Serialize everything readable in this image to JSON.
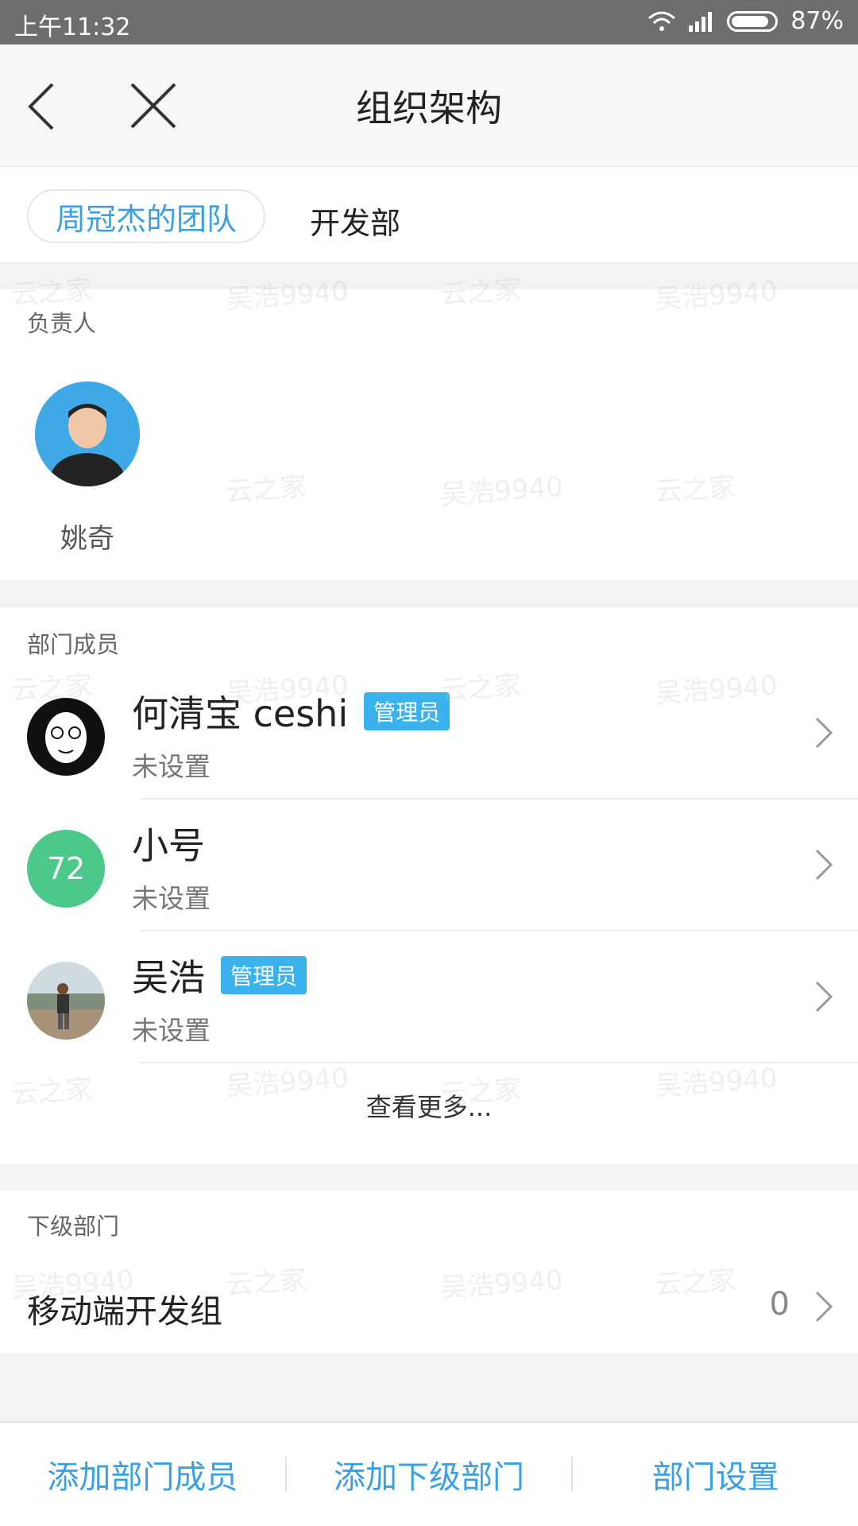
{
  "status_bar": {
    "time": "上午11:32",
    "battery_percent": "87%"
  },
  "nav": {
    "title": "组织架构",
    "back_icon": "chevron-left-icon",
    "close_icon": "close-icon"
  },
  "breadcrumb": {
    "root": "周冠杰的团队",
    "current": "开发部"
  },
  "owner_section": {
    "label": "负责人",
    "owner_name": "姚奇"
  },
  "members_section": {
    "label": "部门成员",
    "members": [
      {
        "name": "何清宝 ceshi",
        "badge": "管理员",
        "subtitle": "未设置"
      },
      {
        "name": "小号",
        "avatar_text": "72",
        "subtitle": "未设置"
      },
      {
        "name": "吴浩",
        "badge": "管理员",
        "subtitle": "未设置"
      }
    ],
    "more_label": "查看更多..."
  },
  "sub_departments": {
    "label": "下级部门",
    "items": [
      {
        "name": "移动端开发组",
        "count": "0"
      }
    ]
  },
  "bottom_actions": {
    "add_member": "添加部门成员",
    "add_sub_dept": "添加下级部门",
    "dept_settings": "部门设置"
  },
  "watermarks": {
    "a": "云之家",
    "b": "吴浩9940"
  },
  "colors": {
    "accent": "#3aa0e6",
    "badge": "#3ab2ee",
    "avatar_green": "#4cc88a",
    "status_bar": "#6e6e6e"
  }
}
